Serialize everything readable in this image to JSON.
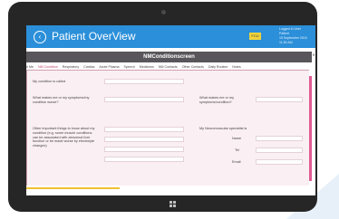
{
  "header": {
    "title": "Patient OverView",
    "user_badge": "FCU",
    "user_info": [
      "Logged In User",
      "Patient",
      "15 September 2015",
      "11:30 AM"
    ]
  },
  "form": {
    "title": "NMConditionscreen",
    "tabs": [
      "e Me",
      "NM Condition",
      "Respiratory",
      "Cardiac",
      "Acute Plasma",
      "Speech",
      "Medicines",
      "NM Contacts",
      "Other Contacts",
      "Daily Routine",
      "Notes"
    ],
    "labels": {
      "my_condition": "My condition is called",
      "symptoms_worse": "What makes me or my symptoms/my condition worse?",
      "symptoms_better": "What makes me or my symptoms/condition?",
      "other_things": "Other important things to know about my condition (e.g. some muscle conditions can be associated with abnormal liver function or be made worse by electrolyte changes)",
      "specialist": "My Neuromuscular specialist is",
      "name": "Name",
      "tel": "Tel",
      "email": "Email"
    }
  },
  "colors": {
    "header": "#2b8fd9",
    "form_header": "#58565a",
    "panel": "#faeff3",
    "accent": "#e05a93",
    "badge": "#f2d33a"
  }
}
